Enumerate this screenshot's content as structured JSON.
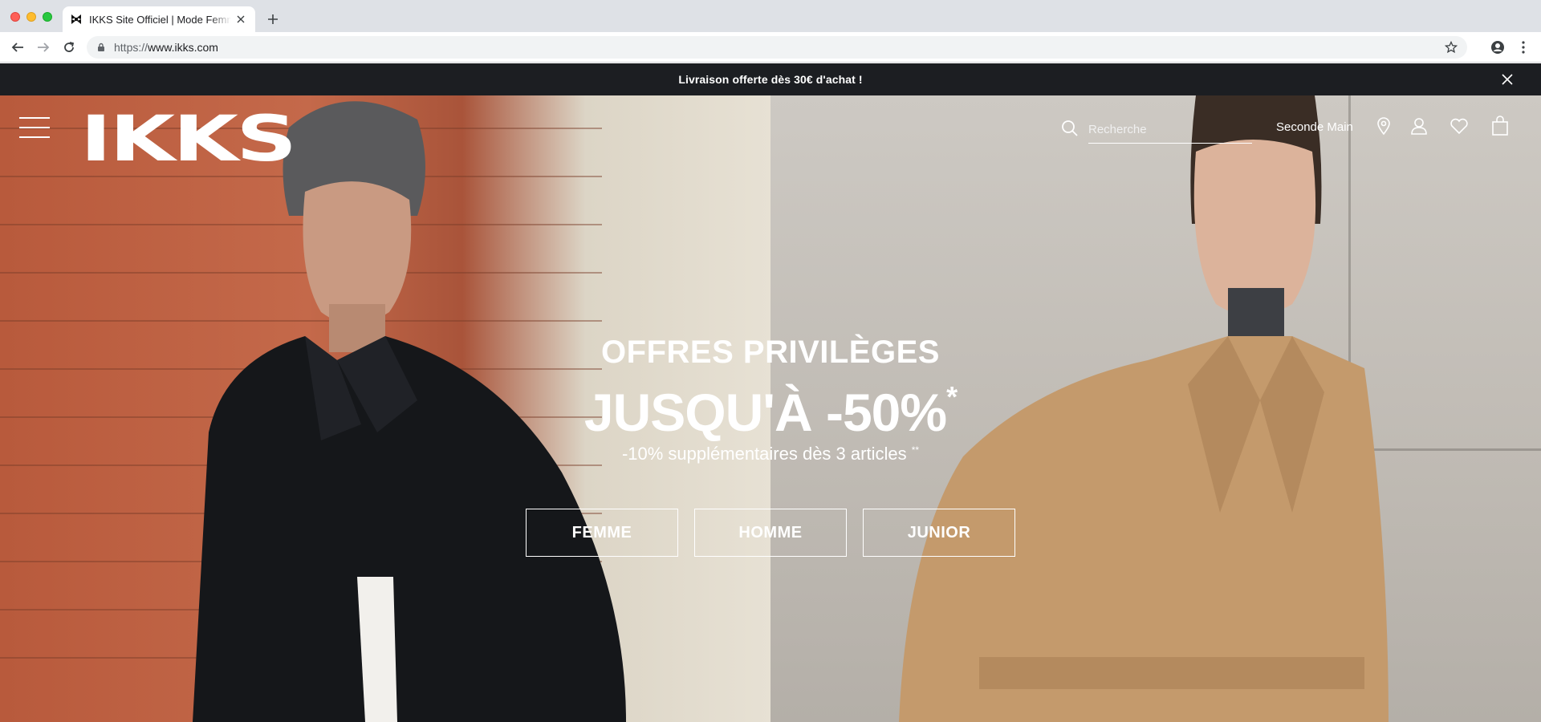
{
  "browser": {
    "tab_title": "IKKS Site Officiel | Mode Femme",
    "url_protocol": "https://",
    "url_host": "www.ikks.com"
  },
  "site": {
    "promo_text": "Livraison offerte dès 30€ d'achat !",
    "logo_text": "IKKS",
    "search_placeholder": "Recherche",
    "seconde_main_label": "Seconde Main",
    "hero": {
      "kicker": "OFFRES PRIVILÈGES",
      "headline": "JUSQU'À -50%",
      "headline_mark": "*",
      "subline": "-10% supplémentaires dès 3 articles",
      "subline_mark": "**",
      "buttons": [
        "FEMME",
        "HOMME",
        "JUNIOR"
      ]
    }
  },
  "colors": {
    "promo_bar": "#1c1e22",
    "brick": "#c4694a",
    "coat": "#c49a6c",
    "jacket": "#15171a"
  }
}
